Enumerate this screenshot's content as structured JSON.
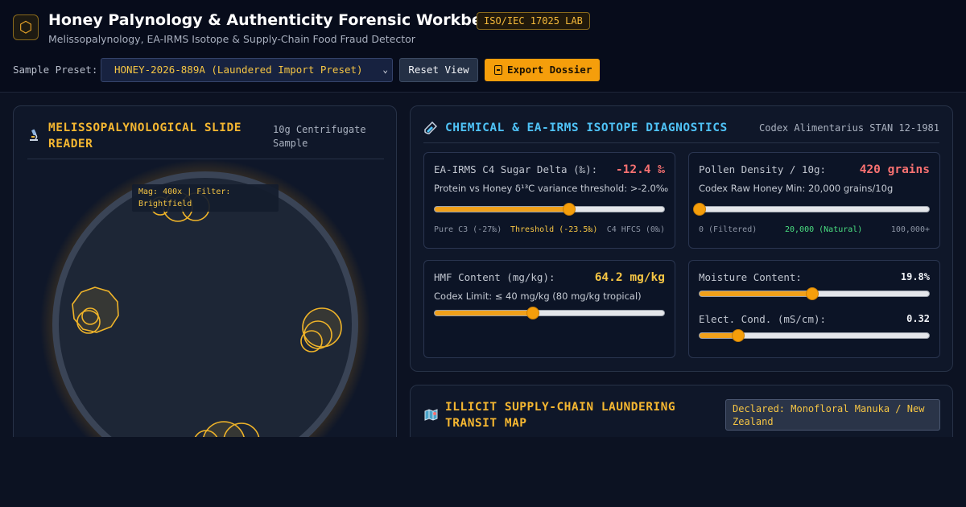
{
  "header": {
    "logo_glyph": "⬡",
    "title": "Honey Palynology & Authenticity Forensic Workbench",
    "badge": "ISO/IEC 17025 LAB",
    "subtitle": "Melissopalynology, EA-IRMS Isotope & Supply-Chain Food Fraud Detector"
  },
  "toolbar": {
    "preset_label": "Sample Preset:",
    "preset_value": "HONEY-2026-889A (Laundered Import Preset)",
    "reset_label": "Reset View",
    "export_label": "Export Dossier",
    "accent_color": "#f59e0b"
  },
  "slide_reader": {
    "icon": "microscope-icon",
    "title_line1": "MELISSOPALYNOLOGICAL SLIDE",
    "title_line2": "READER",
    "meta_line1": "10g Centrifugate",
    "meta_line2": "Sample",
    "overlay_line1": "Mag: 400x | Filter:",
    "overlay_line2": "Brightfield"
  },
  "diagnostics": {
    "icon": "test-tube-icon",
    "title": "CHEMICAL & EA-IRMS ISOTOPE DIAGNOSTICS",
    "standard": "Codex Alimentarius STAN 12-1981",
    "c4": {
      "label": "EA-IRMS C4 Sugar Delta (‰):",
      "value": "-12.4 ‰",
      "note": "Protein vs Honey δ¹³C variance threshold: >-2.0‰",
      "level": 0.585,
      "tick_left": "Pure C3 (-27‰)",
      "tick_mid": "Threshold (-23.5‰)",
      "tick_right": "C4 HFCS (0‰)",
      "value_color": "#f87171",
      "threshold_color": "#f5c544"
    },
    "pollen": {
      "label": "Pollen Density / 10g:",
      "value": "420 grains",
      "note": "Codex Raw Honey Min: 20,000 grains/10g",
      "level": 0.003,
      "tick_left": "0 (Filtered)",
      "tick_mid": "20,000 (Natural)",
      "tick_right": "100,000+",
      "value_color": "#f87171",
      "natural_color": "#4ade80"
    },
    "hmf": {
      "label": "HMF Content (mg/kg):",
      "value": "64.2 mg/kg",
      "note": "Codex Limit: ≤ 40 mg/kg (80 mg/kg tropical)",
      "level": 0.43,
      "value_color": "#f5c544"
    },
    "moisture": {
      "label": "Moisture Content:",
      "value": "19.8%",
      "level": 0.49
    },
    "conductivity": {
      "label": "Elect. Cond. (mS/cm):",
      "value": "0.32",
      "level": 0.17
    }
  },
  "transit_map": {
    "icon": "map-icon",
    "title_line1": "ILLICIT SUPPLY-CHAIN LAUNDERING",
    "title_line2": "TRANSIT MAP",
    "declared": "Declared: Monofloral Manuka / New Zealand"
  }
}
